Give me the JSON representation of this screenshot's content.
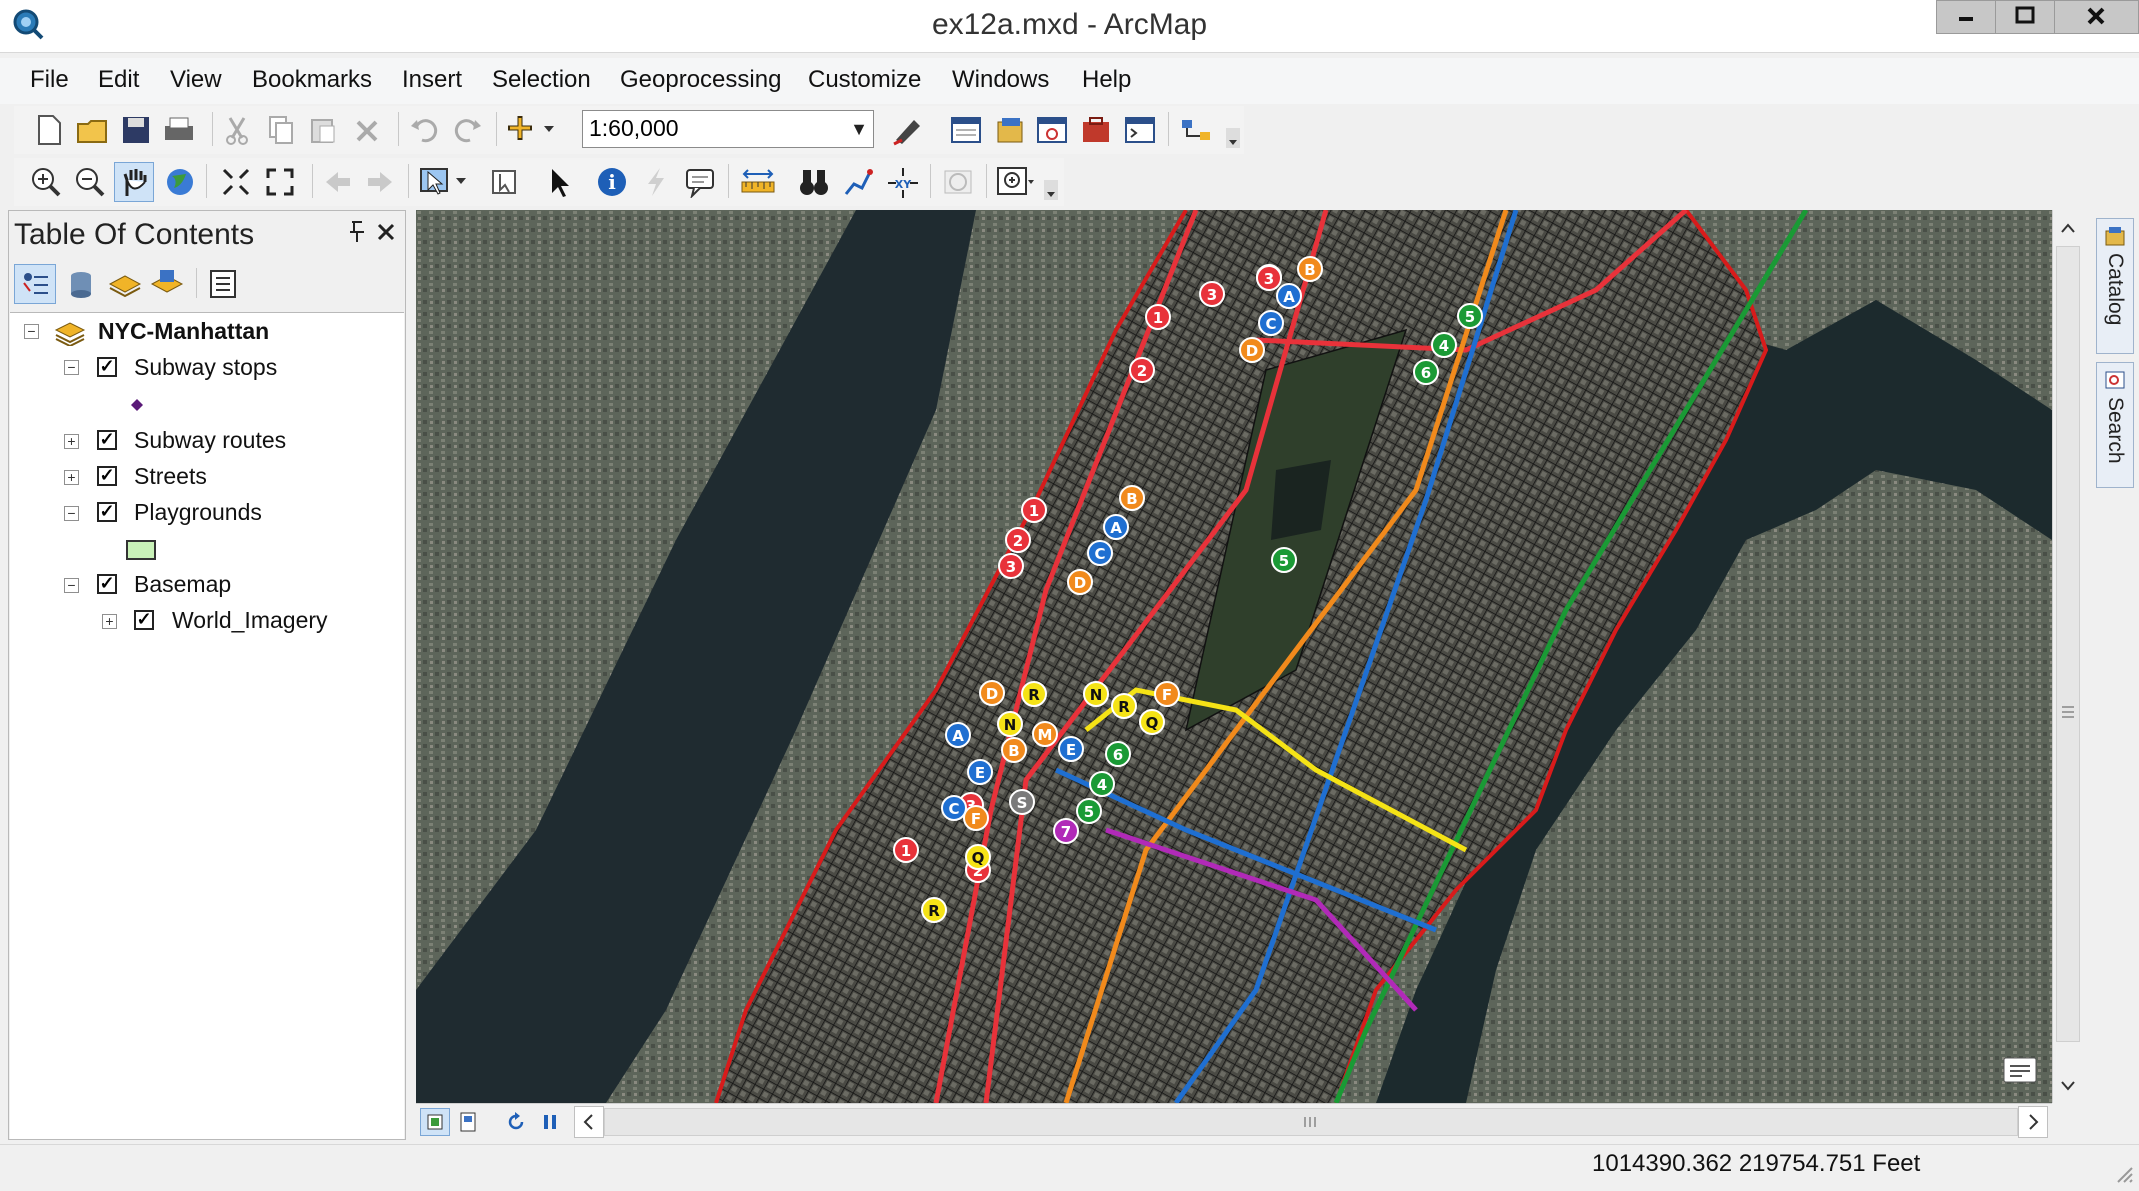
{
  "window": {
    "title": "ex12a.mxd - ArcMap"
  },
  "menu": [
    "File",
    "Edit",
    "View",
    "Bookmarks",
    "Insert",
    "Selection",
    "Geoprocessing",
    "Customize",
    "Windows",
    "Help"
  ],
  "toolbar": {
    "scale": "1:60,000"
  },
  "toc": {
    "title": "Table Of Contents",
    "root": "NYC-Manhattan",
    "layers": [
      {
        "label": "Subway stops",
        "checked": true
      },
      {
        "label": "Subway routes",
        "checked": true
      },
      {
        "label": "Streets",
        "checked": true
      },
      {
        "label": "Playgrounds",
        "checked": true
      },
      {
        "label": "Basemap",
        "checked": true
      },
      {
        "label": "World_Imagery",
        "checked": true
      }
    ]
  },
  "dock": {
    "catalog": "Catalog",
    "search": "Search"
  },
  "status": {
    "coordinates": "1014390.362  219754.751 Feet"
  },
  "colors": {
    "route_red": "#e8323a",
    "route_blue": "#1f6fd1",
    "route_orange": "#f18a1c",
    "route_green": "#1a9a35",
    "route_yellow": "#f5e316",
    "route_purple": "#b12ab8",
    "shoreline": "#d81b1b"
  },
  "map_labels": {
    "red": [
      "1",
      "2",
      "3",
      "2",
      "3",
      "1",
      "2",
      "3",
      "3",
      "2",
      "1"
    ],
    "orange": [
      "B",
      "D",
      "B",
      "D",
      "D",
      "B",
      "F",
      "M",
      "F"
    ],
    "blue": [
      "A",
      "C",
      "A",
      "C",
      "A",
      "E",
      "C",
      "E"
    ],
    "green": [
      "5",
      "4",
      "6",
      "5",
      "6",
      "4",
      "5"
    ],
    "yellow": [
      "R",
      "N",
      "R",
      "Q",
      "N",
      "Q",
      "R"
    ],
    "gray": [
      "S"
    ],
    "purple": [
      "7"
    ]
  }
}
